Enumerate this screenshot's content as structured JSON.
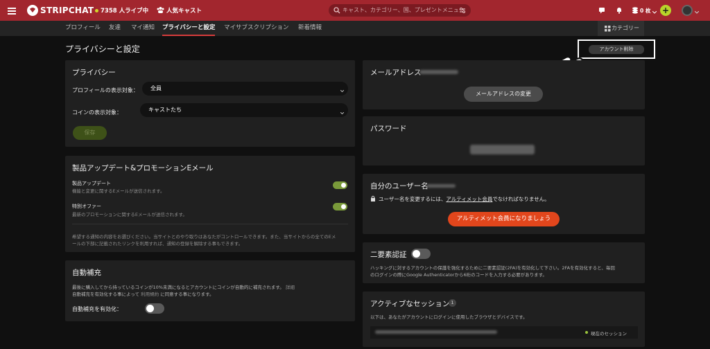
{
  "header": {
    "brand": "STRIPCHAT",
    "live_count": "7358 人ライブ中",
    "popular": "人気キャスト",
    "search_placeholder": "キャスト、カテゴリー、国、プレゼントメニュー",
    "tokens": "0 枚",
    "plus": "+",
    "accent": "#a2262e"
  },
  "nav": {
    "tabs": [
      "プロフィール",
      "友達",
      "マイ通知",
      "プライバシーと設定",
      "マイサブスクリプション",
      "新着情報"
    ],
    "active": "プライバシーと設定",
    "categories": "カテゴリー"
  },
  "page": {
    "title": "プライバシーと設定",
    "delete_account": "アカウント削除"
  },
  "privacy": {
    "title": "プライバシー",
    "profile_visibility_label": "プロフィールの表示対象：",
    "profile_visibility_value": "全員",
    "coin_visibility_label": "コインの表示対象：",
    "coin_visibility_value": "キャストたち",
    "save": "保存"
  },
  "emails": {
    "title": "製品アップデート&プロモーションEメール",
    "item1_title": "製品アップデート",
    "item1_desc": "機能と変更に関するEメールが送信されます。",
    "item2_title": "特別オファー",
    "item2_desc": "最新のプロモーションに関するEメールが送信されます。",
    "note_line1": "希望する通知の内容をお選びください。当サイトとのやり取りはあなたがコントロールできます。また、当サイトからの全てのEメ",
    "note_line2": "ールの下部に記載されたリンクを利用すれば、通知の登録を解除する事もできます。"
  },
  "autofill": {
    "title": "自動補充",
    "desc_line1": "最後に購入してから持っているコインが10%未満になるとアカウントにコインが自動的に補充されます。",
    "desc_line1_link": "詳細",
    "desc_line2_pre": "自動補充を有効化する事によって",
    "desc_line2_link": "利用規約",
    "desc_line2_post": "に同意する事になります。",
    "enable_label": "自動補充を有効化："
  },
  "email_address": {
    "title": "メールアドレス",
    "change": "メールアドレスの変更"
  },
  "password": {
    "title": "パスワード"
  },
  "username": {
    "title": "自分のユーザー名",
    "notice_pre": "ユーザー名を変更するには、",
    "notice_link": "アルティメット会員",
    "notice_post": "でなければなりません。",
    "upgrade": "アルティメット会員になりましょう"
  },
  "two_factor": {
    "title": "二要素認証",
    "desc_line1": "ハッキングに対するアカウントの保護を強化するために二要素認証(2FA)を有効化して下さい。2FAを有効化すると、毎回",
    "desc_line2": "のログインの際にGoogle Authenticatorから6桁のコードを入力する必要があります。"
  },
  "sessions": {
    "title": "アクティブなセッション",
    "count": "1",
    "desc": "以下は、あなたがアカウントにログインに使用したブラウザとデバイスです。",
    "current": "現在のセッション"
  }
}
